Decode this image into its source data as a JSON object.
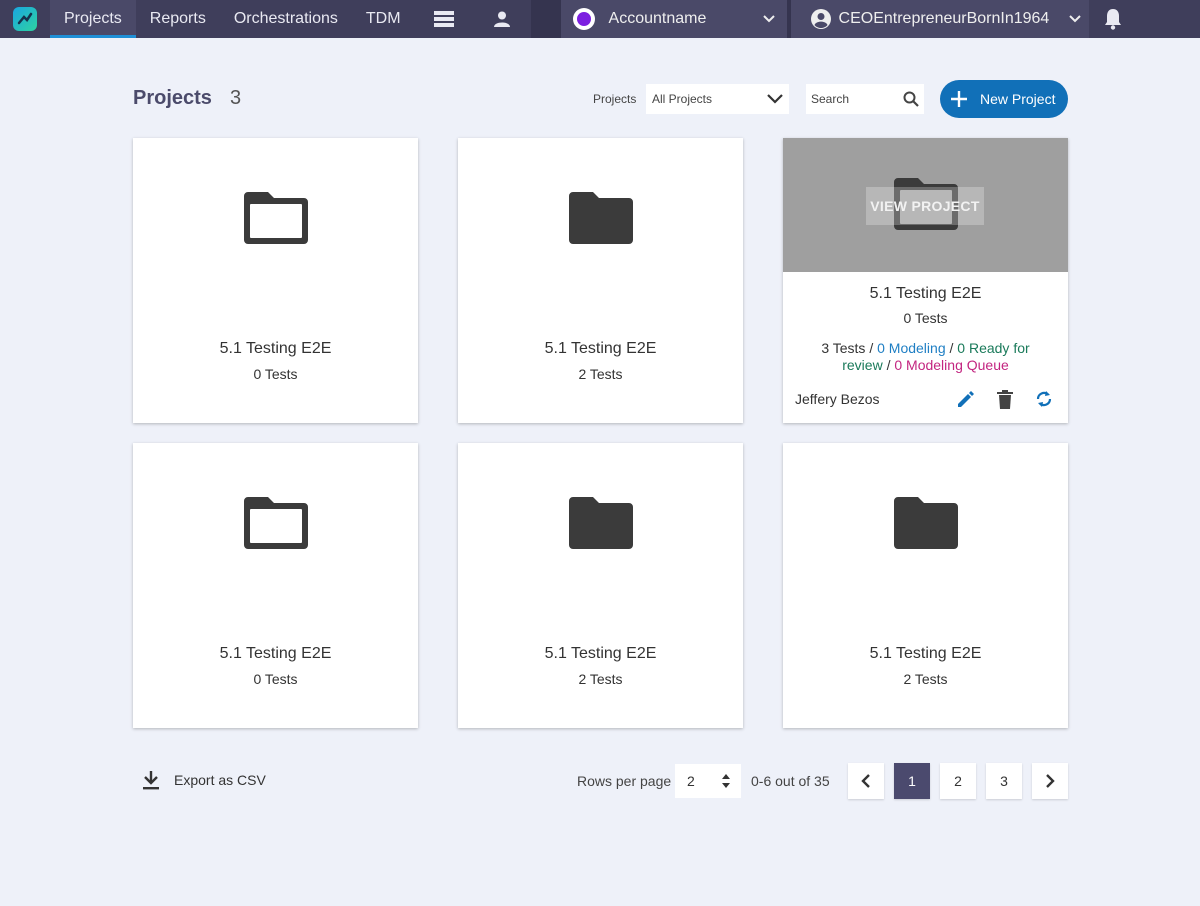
{
  "nav": {
    "items": [
      {
        "label": "Projects",
        "active": true
      },
      {
        "label": "Reports"
      },
      {
        "label": "Orchestrations"
      },
      {
        "label": "TDM"
      }
    ],
    "icons": [
      "table-rows-icon",
      "person-icon"
    ],
    "account": {
      "name": "Accountname",
      "color": "#7c1fe0"
    },
    "user": {
      "name": "CEOEntrepreneurBornIn1964"
    }
  },
  "header": {
    "title": "Projects",
    "count": "3",
    "filter_label": "Projects",
    "filter_value": "All Projects",
    "search_placeholder": "Search",
    "new_button": "New Project"
  },
  "cards": [
    {
      "name": "5.1 Testing E2E",
      "tests": "0 Tests",
      "icon": "folder-outline-icon"
    },
    {
      "name": "5.1 Testing E2E",
      "tests": "2 Tests",
      "icon": "folder-filled-icon"
    },
    {
      "name": "5.1 Testing E2E",
      "tests": "0 Tests",
      "icon": "folder-outline-icon",
      "view_label": "VIEW PROJECT",
      "stats": {
        "total": "3 Tests",
        "modeling": "0 Modeling",
        "ready_a": "0 Ready for",
        "ready_b": "review",
        "queue": "0 Modeling Queue"
      },
      "owner": "Jeffery Bezos"
    },
    {
      "name": "5.1 Testing E2E",
      "tests": "0 Tests",
      "icon": "folder-outline-icon"
    },
    {
      "name": "5.1 Testing E2E",
      "tests": "2 Tests",
      "icon": "folder-filled-icon"
    },
    {
      "name": "5.1 Testing E2E",
      "tests": "2 Tests",
      "icon": "folder-filled-icon"
    }
  ],
  "footer": {
    "export_label": "Export as CSV",
    "rows_label": "Rows per page",
    "rows_value": "2",
    "range": "0-6 out of 35",
    "pages": [
      "1",
      "2",
      "3"
    ],
    "current_page": "1"
  },
  "colors": {
    "topbar": "#3f3e5b",
    "primary": "#1170b8",
    "page_active": "#4b4a6e",
    "modeling": "#1f7fc4",
    "ready": "#1a7a5a",
    "queue": "#c32580"
  }
}
